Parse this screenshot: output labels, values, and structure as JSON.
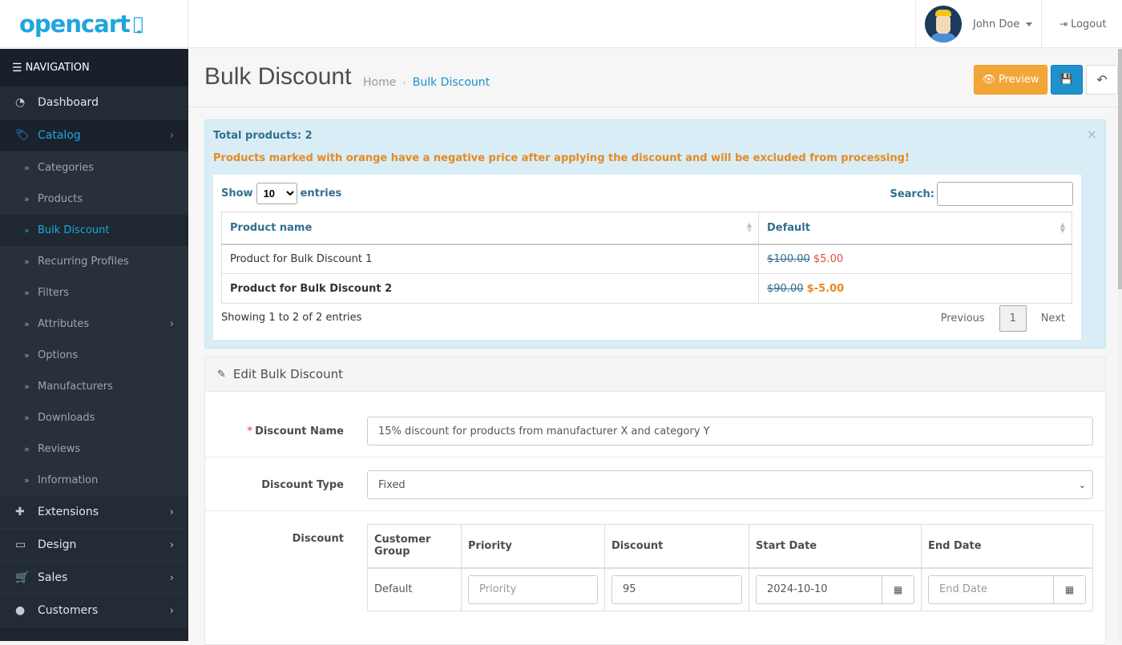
{
  "header": {
    "logo_text": "opencart",
    "logo_cart": "·̣·",
    "user_name": "John Doe",
    "logout_label": "Logout"
  },
  "sidebar": {
    "nav_title": "NAVIGATION",
    "items": [
      {
        "label": "Dashboard",
        "icon": "dashboard-icon"
      },
      {
        "label": "Catalog",
        "icon": "tags-icon",
        "active": true
      },
      {
        "label": "Extensions",
        "icon": "puzzle-icon"
      },
      {
        "label": "Design",
        "icon": "desktop-icon"
      },
      {
        "label": "Sales",
        "icon": "cart-icon"
      },
      {
        "label": "Customers",
        "icon": "user-icon"
      }
    ],
    "catalog_sub": [
      {
        "label": "Categories"
      },
      {
        "label": "Products"
      },
      {
        "label": "Bulk Discount",
        "active": true
      },
      {
        "label": "Recurring Profiles"
      },
      {
        "label": "Filters"
      },
      {
        "label": "Attributes",
        "has_children": true
      },
      {
        "label": "Options"
      },
      {
        "label": "Manufacturers"
      },
      {
        "label": "Downloads"
      },
      {
        "label": "Reviews"
      },
      {
        "label": "Information"
      }
    ]
  },
  "page": {
    "title": "Bulk Discount",
    "breadcrumb": [
      "Home",
      "Bulk Discount"
    ],
    "preview_label": "Preview"
  },
  "alert": {
    "total": "Total products: 2",
    "warning": "Products marked with orange have a negative price after applying the discount and will be excluded from processing!",
    "show_label": "Show",
    "entries_label": "entries",
    "page_length": "10",
    "search_label": "Search:",
    "search_value": "",
    "columns": [
      "Product name",
      "Default"
    ],
    "rows": [
      {
        "name": "Product for Bulk Discount 1",
        "old_price": "$100.00",
        "new_price": "$5.00",
        "negative": false
      },
      {
        "name": "Product for Bulk Discount 2",
        "old_price": "$90.00",
        "new_price": "$-5.00",
        "negative": true
      }
    ],
    "info": "Showing 1 to 2 of 2 entries",
    "pagination": {
      "previous": "Previous",
      "current": "1",
      "next": "Next"
    }
  },
  "form": {
    "panel_title": "Edit Bulk Discount",
    "discount_name_label": "Discount Name",
    "discount_name_value": "15% discount for products from manufacturer X and category Y",
    "discount_type_label": "Discount Type",
    "discount_type_value": "Fixed",
    "discount_label": "Discount",
    "table": {
      "columns": [
        "Customer Group",
        "Priority",
        "Discount",
        "Start Date",
        "End Date"
      ],
      "row": {
        "customer_group": "Default",
        "priority_placeholder": "Priority",
        "priority_value": "",
        "discount_value": "95",
        "start_date": "2024-10-10",
        "end_date_placeholder": "End Date"
      }
    }
  }
}
